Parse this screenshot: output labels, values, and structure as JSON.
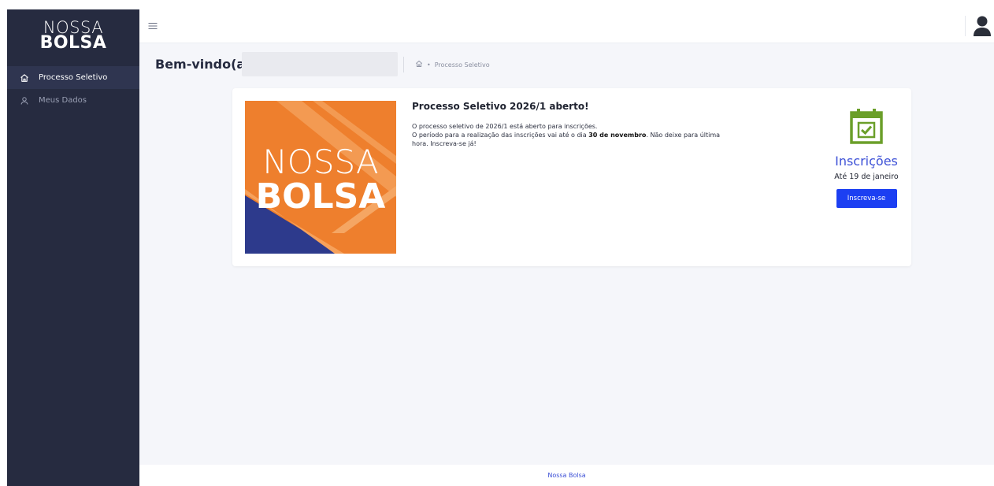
{
  "brand": {
    "line1": "NOSSA",
    "line2": "BOLSA"
  },
  "sidebar": {
    "items": [
      {
        "label": "Processo Seletivo",
        "icon": "home-icon",
        "active": true
      },
      {
        "label": "Meus Dados",
        "icon": "user-icon",
        "active": false
      }
    ]
  },
  "header": {
    "menu_icon": "hamburger-icon",
    "avatar_icon": "user-avatar-icon"
  },
  "main": {
    "welcome": "Bem-vindo(a),",
    "breadcrumb": {
      "separator": "•",
      "current": "Processo Seletivo"
    }
  },
  "card": {
    "title": "Processo Seletivo 2026/1 aberto!",
    "line1": "O processo seletivo de 2026/1 está aberto para inscrições.",
    "line2_start": "O período para a realização das inscrições vai até o dia ",
    "line2_bold": "30 de novembro",
    "line2_end": ". Não deixe para última hora. Inscreva-se já!",
    "inscricoes_title": "Inscrições",
    "inscricoes_date": "Até 19 de janeiro",
    "button_label": "Inscreva-se"
  },
  "footer": {
    "text": "Nossa Bolsa"
  },
  "colors": {
    "sidebar": "#262b40",
    "accent_blue": "#3b4fd6",
    "button": "#1c3ff2",
    "banner_orange": "#ee7f2d",
    "banner_blue": "#2d3a8c",
    "calendar_green": "#6b9f2a"
  }
}
